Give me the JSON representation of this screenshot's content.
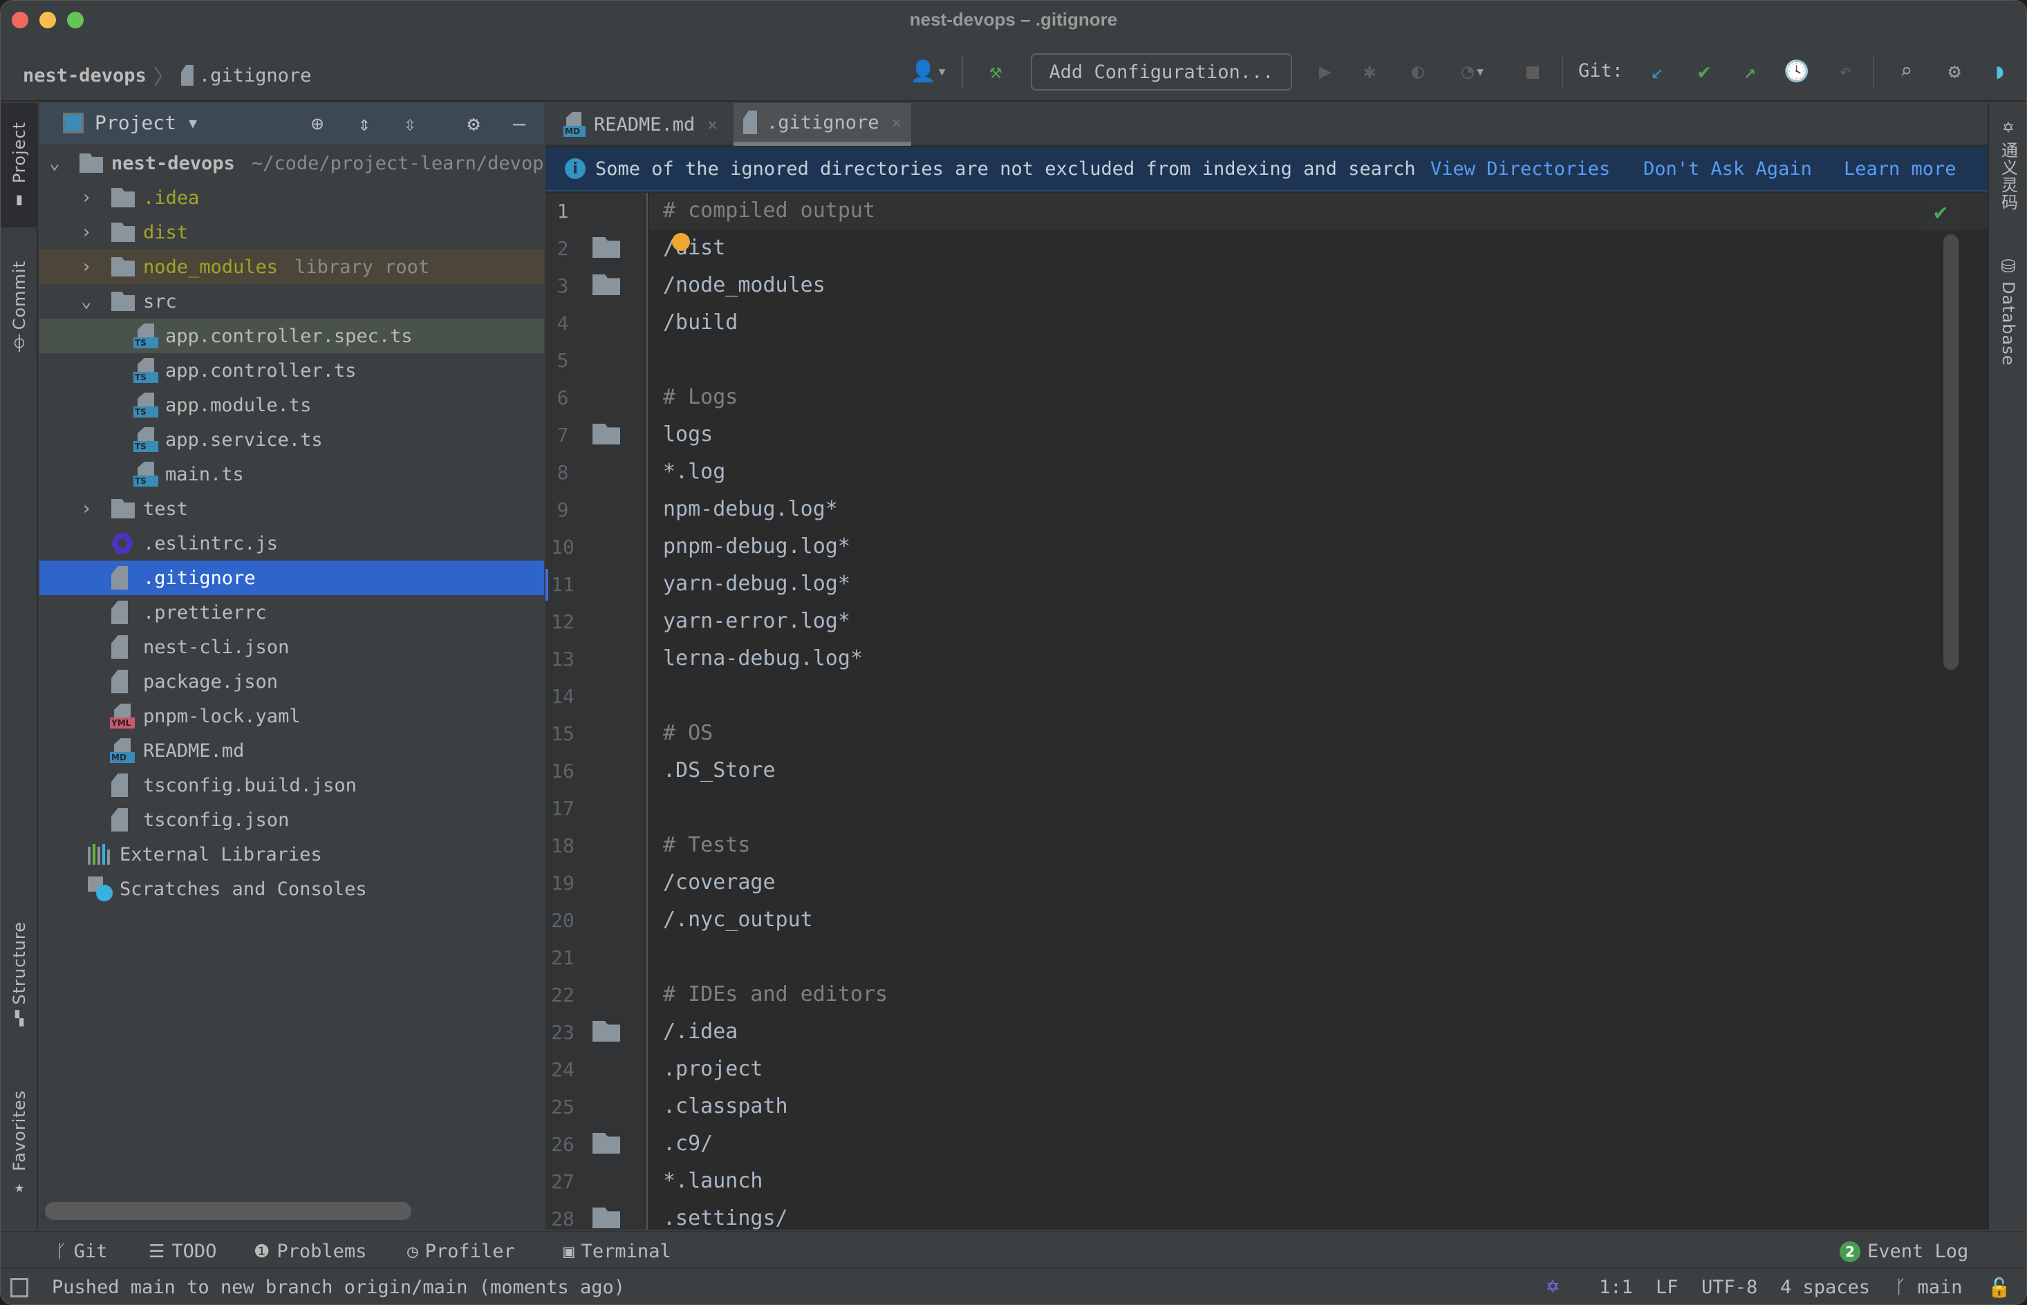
{
  "window": {
    "title": "nest-devops – .gitignore"
  },
  "navbar": {
    "breadcrumb_project": "nest-devops",
    "breadcrumb_separator": "〉",
    "breadcrumb_file": ".gitignore",
    "add_configuration_label": "Add Configuration...",
    "git_label": "Git:",
    "icons": [
      "user-icon",
      "build-hammer-icon",
      "run-icon",
      "debug-icon",
      "coverage-icon",
      "profile-icon",
      "stop-icon",
      "git-update-icon",
      "git-commit-icon",
      "git-push-icon",
      "history-icon",
      "rollback-icon",
      "search-icon",
      "settings-icon",
      "toolbox-icon"
    ]
  },
  "left_strip": {
    "tabs": [
      {
        "label": "Project",
        "icon": "folder-icon",
        "active": true
      },
      {
        "label": "Commit",
        "icon": "commit-icon",
        "active": false
      },
      {
        "label": "Structure",
        "icon": "structure-icon",
        "active": false
      },
      {
        "label": "Favorites",
        "icon": "star-icon",
        "active": false
      }
    ]
  },
  "right_strip": {
    "tabs": [
      {
        "label": "通义灵码",
        "icon": "tongyi-icon"
      },
      {
        "label": "Database",
        "icon": "database-icon"
      }
    ]
  },
  "project_panel": {
    "title": "Project",
    "caret": "▼",
    "tree": [
      {
        "label": "nest-devops",
        "hint": "~/code/project-learn/devops",
        "type": "project-root",
        "expanded": true,
        "depth": 0
      },
      {
        "label": ".idea",
        "type": "folder",
        "expanded": false,
        "depth": 1,
        "style": "olive"
      },
      {
        "label": "dist",
        "type": "folder",
        "expanded": false,
        "depth": 1,
        "style": "olive"
      },
      {
        "label": "node_modules",
        "hint": "library root",
        "type": "folder",
        "expanded": false,
        "depth": 1,
        "style": "olive",
        "row": "ignored"
      },
      {
        "label": "src",
        "type": "folder",
        "expanded": true,
        "depth": 1
      },
      {
        "label": "app.controller.spec.ts",
        "type": "ts-test",
        "depth": 2,
        "row": "changed"
      },
      {
        "label": "app.controller.ts",
        "type": "ts",
        "depth": 2
      },
      {
        "label": "app.module.ts",
        "type": "ts",
        "depth": 2
      },
      {
        "label": "app.service.ts",
        "type": "ts",
        "depth": 2
      },
      {
        "label": "main.ts",
        "type": "ts",
        "depth": 2
      },
      {
        "label": "test",
        "type": "folder",
        "expanded": false,
        "depth": 1
      },
      {
        "label": ".eslintrc.js",
        "type": "eslint",
        "depth": 1
      },
      {
        "label": ".gitignore",
        "type": "gitignore",
        "depth": 1,
        "row": "selected"
      },
      {
        "label": ".prettierrc",
        "type": "plain",
        "depth": 1
      },
      {
        "label": "nest-cli.json",
        "type": "json",
        "depth": 1
      },
      {
        "label": "package.json",
        "type": "json",
        "depth": 1
      },
      {
        "label": "pnpm-lock.yaml",
        "type": "yaml",
        "depth": 1
      },
      {
        "label": "README.md",
        "type": "md",
        "depth": 1
      },
      {
        "label": "tsconfig.build.json",
        "type": "json",
        "depth": 1
      },
      {
        "label": "tsconfig.json",
        "type": "json",
        "depth": 1
      },
      {
        "label": "External Libraries",
        "type": "ext-lib",
        "depth": 0
      },
      {
        "label": "Scratches and Consoles",
        "type": "scratch",
        "depth": 0
      }
    ]
  },
  "editor": {
    "tabs": [
      {
        "label": "README.md",
        "icon": "markdown-file-icon",
        "active": false
      },
      {
        "label": ".gitignore",
        "icon": "gitignore-file-icon",
        "active": true
      }
    ],
    "banner": {
      "message": "Some of the ignored directories are not excluded from indexing and search",
      "actions": [
        "View Directories",
        "Don't Ask Again",
        "Learn more"
      ]
    },
    "current_line": 1,
    "lines": [
      {
        "n": 1,
        "text": "# compiled output",
        "comment": true
      },
      {
        "n": 2,
        "text": "/dist",
        "folder": true
      },
      {
        "n": 3,
        "text": "/node_modules",
        "folder": true
      },
      {
        "n": 4,
        "text": "/build"
      },
      {
        "n": 5,
        "text": ""
      },
      {
        "n": 6,
        "text": "# Logs",
        "comment": true
      },
      {
        "n": 7,
        "text": "logs",
        "folder": true
      },
      {
        "n": 8,
        "text": "*.log"
      },
      {
        "n": 9,
        "text": "npm-debug.log*"
      },
      {
        "n": 10,
        "text": "pnpm-debug.log*"
      },
      {
        "n": 11,
        "text": "yarn-debug.log*",
        "changed": true
      },
      {
        "n": 12,
        "text": "yarn-error.log*"
      },
      {
        "n": 13,
        "text": "lerna-debug.log*"
      },
      {
        "n": 14,
        "text": ""
      },
      {
        "n": 15,
        "text": "# OS",
        "comment": true
      },
      {
        "n": 16,
        "text": ".DS_Store"
      },
      {
        "n": 17,
        "text": ""
      },
      {
        "n": 18,
        "text": "# Tests",
        "comment": true
      },
      {
        "n": 19,
        "text": "/coverage"
      },
      {
        "n": 20,
        "text": "/.nyc_output"
      },
      {
        "n": 21,
        "text": ""
      },
      {
        "n": 22,
        "text": "# IDEs and editors",
        "comment": true
      },
      {
        "n": 23,
        "text": "/.idea",
        "folder": true
      },
      {
        "n": 24,
        "text": ".project"
      },
      {
        "n": 25,
        "text": ".classpath"
      },
      {
        "n": 26,
        "text": ".c9/",
        "folder": true
      },
      {
        "n": 27,
        "text": "*.launch"
      },
      {
        "n": 28,
        "text": ".settings/",
        "folder": true
      }
    ],
    "inspection_status": "no-problems-check-icon"
  },
  "bottom_tools": {
    "items": [
      {
        "label": "Git",
        "icon": "git-branch-icon"
      },
      {
        "label": "TODO",
        "icon": "todo-list-icon"
      },
      {
        "label": "Problems",
        "icon": "problems-icon"
      },
      {
        "label": "Profiler",
        "icon": "profiler-icon"
      },
      {
        "label": "Terminal",
        "icon": "terminal-icon"
      }
    ],
    "event_log": {
      "label": "Event Log",
      "count": "2"
    }
  },
  "statusbar": {
    "message": "Pushed main to new branch origin/main (moments ago)",
    "position": "1:1",
    "line_separator": "LF",
    "encoding": "UTF-8",
    "indent": "4 spaces",
    "branch": "main"
  },
  "colors": {
    "selection": "#2f65ca",
    "banner_bg": "#1d3553",
    "link": "#589df6",
    "ignored_row": "#4b4639",
    "changed_row": "#4a5349",
    "ok_green": "#4ca64f"
  }
}
